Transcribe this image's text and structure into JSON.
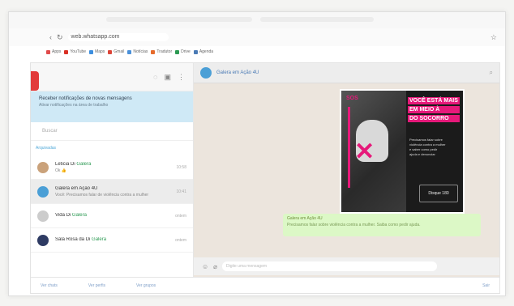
{
  "browser": {
    "url": "web.whatsapp.com",
    "bookmarks": [
      {
        "label": "Apps",
        "color": "#e04b4b"
      },
      {
        "label": "YouTube",
        "color": "#d93025"
      },
      {
        "label": "Maps",
        "color": "#3c8ede"
      },
      {
        "label": "Gmail",
        "color": "#db4437"
      },
      {
        "label": "Notícias",
        "color": "#4a90d9"
      },
      {
        "label": "Tradutor",
        "color": "#e66b2b"
      },
      {
        "label": "Drive",
        "color": "#2c9a53"
      },
      {
        "label": "Agenda",
        "color": "#4a7ab5"
      }
    ]
  },
  "sidebar": {
    "notice_title": "Receber notificações de novas mensagens",
    "notice_sub": "Ativar notificações na área de trabalho",
    "search_placeholder": "Buscar",
    "archived": "Arquivadas",
    "chats": [
      {
        "name": "Leticia Di ",
        "name_bold": "Galera",
        "preview": "Ok 👍",
        "time": "10:58",
        "avatar": "#caa27b",
        "active": false
      },
      {
        "name": "Galera em Ação 4U",
        "name_bold": "",
        "preview": "Você: Precisamos falar de violência contra a mulher",
        "time": "10:41",
        "avatar": "#4b9fd6",
        "active": true
      },
      {
        "name": "Vida Di ",
        "name_bold": "Galera",
        "preview": "",
        "time": "ontem",
        "avatar": "#cccccc",
        "active": false
      },
      {
        "name": "Sala Rosa da Di ",
        "name_bold": "Galera",
        "preview": "",
        "time": "ontem",
        "avatar": "#2e3b63",
        "active": false
      }
    ]
  },
  "conversation": {
    "title": "Galera em Ação 4U",
    "poster": {
      "logo": "SOS",
      "headline": [
        "VOCÊ ESTÁ MAIS",
        "EM MEIO À",
        "DO SOCORRO"
      ],
      "body": [
        "Precisamos falar sobre",
        "violência contra a mulher",
        "e saber como pedir",
        "ajuda e denunciar"
      ],
      "badge": "Disque 180"
    },
    "message_title": "Galera em Ação 4U",
    "message_text": "Precisamos falar sobre violência contra a mulher. Saiba como pedir ajuda.",
    "composer_placeholder": "Digite uma mensagem"
  },
  "footer": {
    "items": [
      "Ver chats",
      "Ver perfis",
      "Ver grupos"
    ],
    "right": "Sair"
  },
  "colors": {
    "accent_pink": "#e6197a",
    "bubble_green": "#dcf8c6",
    "notice_blue": "#cfe9f6"
  }
}
